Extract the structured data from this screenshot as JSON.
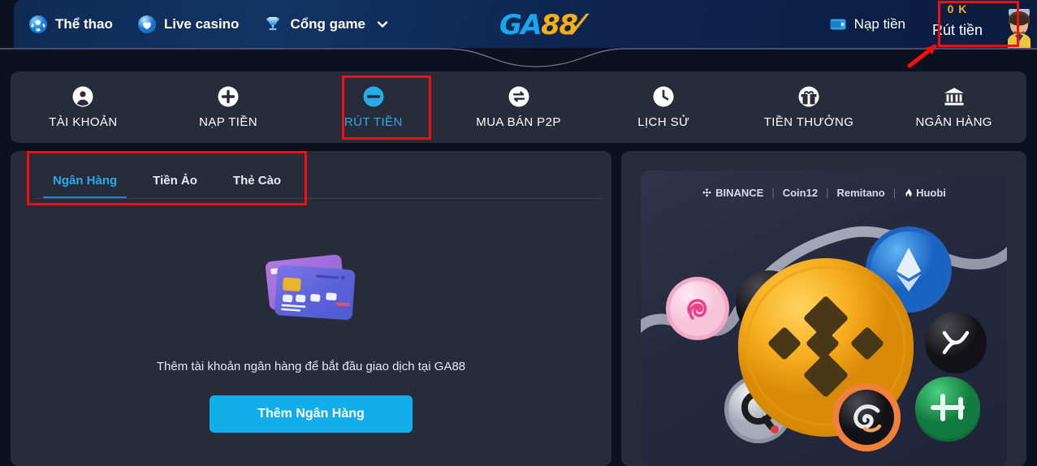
{
  "header": {
    "nav": [
      {
        "label": "Thể thao",
        "icon": "soccer-ball-icon"
      },
      {
        "label": "Live casino",
        "icon": "heart-shield-icon"
      },
      {
        "label": "Cổng game",
        "icon": "trophy-icon",
        "caret": "chevron-down-icon"
      }
    ],
    "logo": {
      "part1": "GA",
      "part2": "88"
    },
    "deposit_label": "Nạp tiền",
    "deposit_icon": "wallet-icon",
    "withdraw_label": "Rút tiền",
    "balance": "0 K",
    "avatar": "user-avatar",
    "colors": {
      "balance": "#f5b018",
      "accent": "#16a7ef",
      "logo_gold": "#f5ae15"
    }
  },
  "main_nav": {
    "items": [
      {
        "label": "TÀI KHOẢN",
        "icon": "user-circle-icon",
        "active": false
      },
      {
        "label": "NẠP TIỀN",
        "icon": "plus-circle-icon",
        "active": false
      },
      {
        "label": "RÚT TIỀN",
        "icon": "minus-circle-icon",
        "active": true
      },
      {
        "label": "MUA BÁN P2P",
        "icon": "exchange-circle-icon",
        "active": false
      },
      {
        "label": "LỊCH SỬ",
        "icon": "clock-icon",
        "active": false
      },
      {
        "label": "TIỀN THƯỞNG",
        "icon": "gift-icon",
        "active": false
      },
      {
        "label": "NGÂN HÀNG",
        "icon": "bank-icon",
        "active": false
      }
    ],
    "active_color": "#29abe8"
  },
  "withdraw_panel": {
    "tabs": [
      {
        "label": "Ngân Hàng",
        "active": true
      },
      {
        "label": "Tiền Ảo",
        "active": false
      },
      {
        "label": "Thẻ Cào",
        "active": false
      }
    ],
    "empty_state": {
      "illustration": "credit-cards-illustration",
      "message": "Thêm tài khoản ngân hàng để bắt đầu giao dịch tại GA88",
      "button_label": "Thêm Ngân Hàng",
      "button_color": "#12aeec"
    }
  },
  "promo_panel": {
    "brands": [
      "BINANCE",
      "Coin12",
      "Remitano",
      "Huobi"
    ],
    "separator": "|",
    "illustration": "crypto-coins-illustration"
  },
  "annotations": {
    "boxes": [
      {
        "name": "withdraw-header-highlight"
      },
      {
        "name": "withdraw-tab-highlight"
      },
      {
        "name": "bank-subtabs-highlight"
      }
    ],
    "arrow": {
      "name": "pointer-arrow",
      "color": "#f60d0d"
    },
    "color": "#f60d0d"
  }
}
